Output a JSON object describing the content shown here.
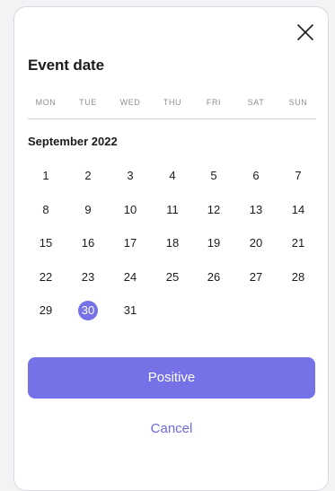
{
  "dialog": {
    "title": "Event date",
    "close_icon": "close-icon"
  },
  "calendar": {
    "weekdays": [
      "MON",
      "TUE",
      "WED",
      "THU",
      "FRI",
      "SAT",
      "SUN"
    ],
    "month_label": "September 2022",
    "days": [
      "1",
      "2",
      "3",
      "4",
      "5",
      "6",
      "7",
      "8",
      "9",
      "10",
      "11",
      "12",
      "13",
      "14",
      "15",
      "16",
      "17",
      "18",
      "19",
      "20",
      "21",
      "22",
      "23",
      "24",
      "25",
      "26",
      "27",
      "28",
      "29",
      "30",
      "31"
    ],
    "selected_day": "30",
    "first_weekday_index": 0
  },
  "actions": {
    "primary_label": "Positive",
    "cancel_label": "Cancel"
  },
  "colors": {
    "accent": "#7472e6",
    "accent_text": "#6c6ad9",
    "text": "#1c1c1e",
    "muted": "#8e8e93"
  }
}
